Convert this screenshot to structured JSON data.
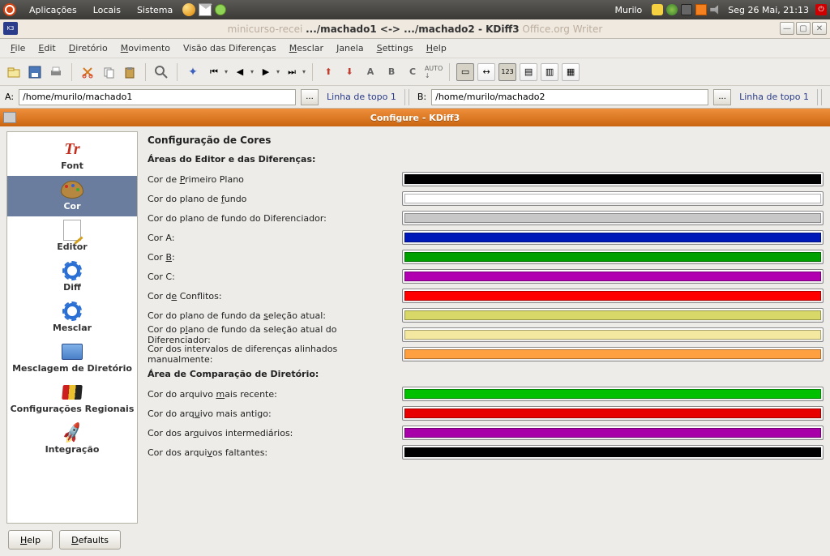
{
  "panel": {
    "menus": [
      "Aplicações",
      "Locais",
      "Sistema"
    ],
    "user": "Murilo",
    "clock": "Seg 26 Mai, 21:13"
  },
  "window": {
    "title_faded_left": "minicurso-recei",
    "title_main": ".../machado1 <-> .../machado2 - KDiff3",
    "title_faded_right": "Office.org Writer"
  },
  "menubar": [
    {
      "l": "File",
      "u": "F"
    },
    {
      "l": "Edit",
      "u": "E"
    },
    {
      "l": "Diretório",
      "u": "D"
    },
    {
      "l": "Movimento",
      "u": "M"
    },
    {
      "l": "Visão das Diferenças",
      "u": ""
    },
    {
      "l": "Mesclar",
      "u": "M"
    },
    {
      "l": "Janela",
      "u": "J"
    },
    {
      "l": "Settings",
      "u": "S"
    },
    {
      "l": "Help",
      "u": "H"
    }
  ],
  "paths": {
    "a_label": "A:",
    "a_value": "/home/murilo/machado1",
    "a_status": "Linha de topo 1",
    "b_label": "B:",
    "b_value": "/home/murilo/machado2",
    "b_status": "Linha de topo 1",
    "dots": "..."
  },
  "child_window": {
    "title": "Configure - KDiff3"
  },
  "categories": [
    {
      "id": "font",
      "label": "Font"
    },
    {
      "id": "cor",
      "label": "Cor"
    },
    {
      "id": "editor",
      "label": "Editor"
    },
    {
      "id": "diff",
      "label": "Diff"
    },
    {
      "id": "mesclar",
      "label": "Mesclar"
    },
    {
      "id": "mescdir",
      "label": "Mesclagem de Diretório"
    },
    {
      "id": "regional",
      "label": "Configurações Regionais"
    },
    {
      "id": "integ",
      "label": "Integração"
    }
  ],
  "settings": {
    "heading": "Configuração de Cores",
    "section1": "Áreas do Editor e das Diferenças:",
    "section2": "Área de Comparação de Diretório:",
    "rows1": [
      {
        "label": "Cor de Primeiro Plano",
        "u": "P",
        "color": "#000000"
      },
      {
        "label": "Cor do plano de fundo",
        "u": "f",
        "color": "#ffffff"
      },
      {
        "label": "Cor do plano de fundo do Diferenciador:",
        "u": "",
        "color": "#c8c8c8"
      },
      {
        "label": "Cor A:",
        "u": "",
        "color": "#0018b8"
      },
      {
        "label": "Cor B:",
        "u": "B",
        "color": "#00a000"
      },
      {
        "label": "Cor C:",
        "u": "",
        "color": "#b000b0"
      },
      {
        "label": "Cor de Conflitos:",
        "u": "e",
        "color": "#ff0000"
      },
      {
        "label": "Cor do plano de fundo da seleção atual:",
        "u": "s",
        "color": "#d8d868"
      },
      {
        "label": "Cor do plano de fundo da seleção atual do Diferenciador:",
        "u": "l",
        "color": "#f4e8a0"
      },
      {
        "label": "Cor dos intervalos de diferenças alinhados manualmente:",
        "u": "",
        "color": "#ffa040"
      }
    ],
    "rows2": [
      {
        "label": "Cor do arquivo mais recente:",
        "u": "m",
        "color": "#00c000"
      },
      {
        "label": "Cor do arquivo mais antigo:",
        "u": "u",
        "color": "#e80000"
      },
      {
        "label": "Cor dos arquivos intermediários:",
        "u": "q",
        "color": "#a800a8"
      },
      {
        "label": "Cor dos arquivos faltantes:",
        "u": "v",
        "color": "#000000"
      }
    ]
  },
  "buttons": {
    "help": "Help",
    "defaults": "Defaults"
  }
}
